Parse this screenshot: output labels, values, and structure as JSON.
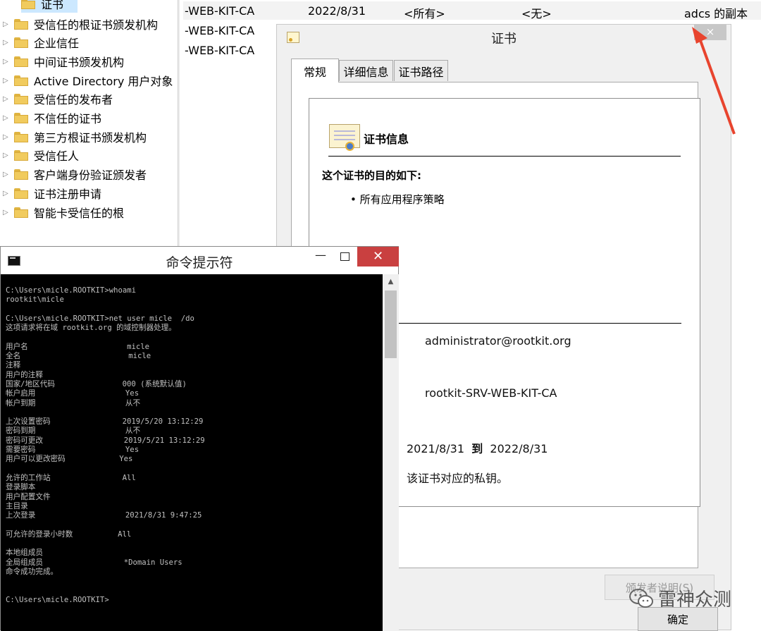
{
  "tree": {
    "items": [
      {
        "label": "证书",
        "selected": true
      },
      {
        "label": "受信任的根证书颁发机构"
      },
      {
        "label": "企业信任"
      },
      {
        "label": "中间证书颁发机构"
      },
      {
        "label": "Active Directory 用户对象"
      },
      {
        "label": "受信任的发布者"
      },
      {
        "label": "不信任的证书"
      },
      {
        "label": "第三方根证书颁发机构"
      },
      {
        "label": "受信任人"
      },
      {
        "label": "客户端身份验证颁发者"
      },
      {
        "label": "证书注册申请"
      },
      {
        "label": "智能卡受信任的根"
      }
    ]
  },
  "list": {
    "row0": {
      "name": "-WEB-KIT-CA",
      "expiry": "2022/8/31",
      "purpose": "<所有>",
      "friendly": "<无>",
      "template": "adcs 的副本"
    },
    "row1": "-WEB-KIT-CA",
    "row2": "-WEB-KIT-CA"
  },
  "cert_dialog": {
    "title": "证书",
    "close_glyph": "×",
    "tabs": [
      "常规",
      "详细信息",
      "证书路径"
    ],
    "info_title": "证书信息",
    "purpose_title": "这个证书的目的如下:",
    "purpose_item": "• 所有应用程序策略",
    "issued_to": "administrator@rootkit.org",
    "issued_by": "rootkit-SRV-WEB-KIT-CA",
    "valid_from": "2021/8/31",
    "valid_to_word": "到",
    "valid_to": "2022/8/31",
    "private_key_note": "该证书对应的私钥。",
    "issuer_statement_button": "颁发者说明(S)",
    "ok_button": "确定"
  },
  "cmd": {
    "title": "命令提示符",
    "min_glyph": "—",
    "close_glyph": "✕",
    "output": "C:\\Users\\micle.ROOTKIT>whoami\nrootkit\\micle\n\nC:\\Users\\micle.ROOTKIT>net user micle  /do\n这项请求将在域 rootkit.org 的域控制器处理。\n\n用户名                      micle\n全名                        micle\n注释\n用户的注释\n国家/地区代码               000 (系统默认值)\n帐户启用                    Yes\n帐户到期                    从不\n\n上次设置密码                2019/5/20 13:12:29\n密码到期                    从不\n密码可更改                  2019/5/21 13:12:29\n需要密码                    Yes\n用户可以更改密码            Yes\n\n允许的工作站                All\n登录脚本\n用户配置文件\n主目录\n上次登录                    2021/8/31 9:47:25\n\n可允许的登录小时数          All\n\n本地组成员\n全局组成员                  *Domain Users\n命令成功完成。\n\n\nC:\\Users\\micle.ROOTKIT>"
  },
  "watermark": {
    "text": "雷神众测"
  },
  "colors": {
    "arrow": "#e8442e",
    "cmd_close": "#c94040",
    "selected": "#cce8ff"
  }
}
